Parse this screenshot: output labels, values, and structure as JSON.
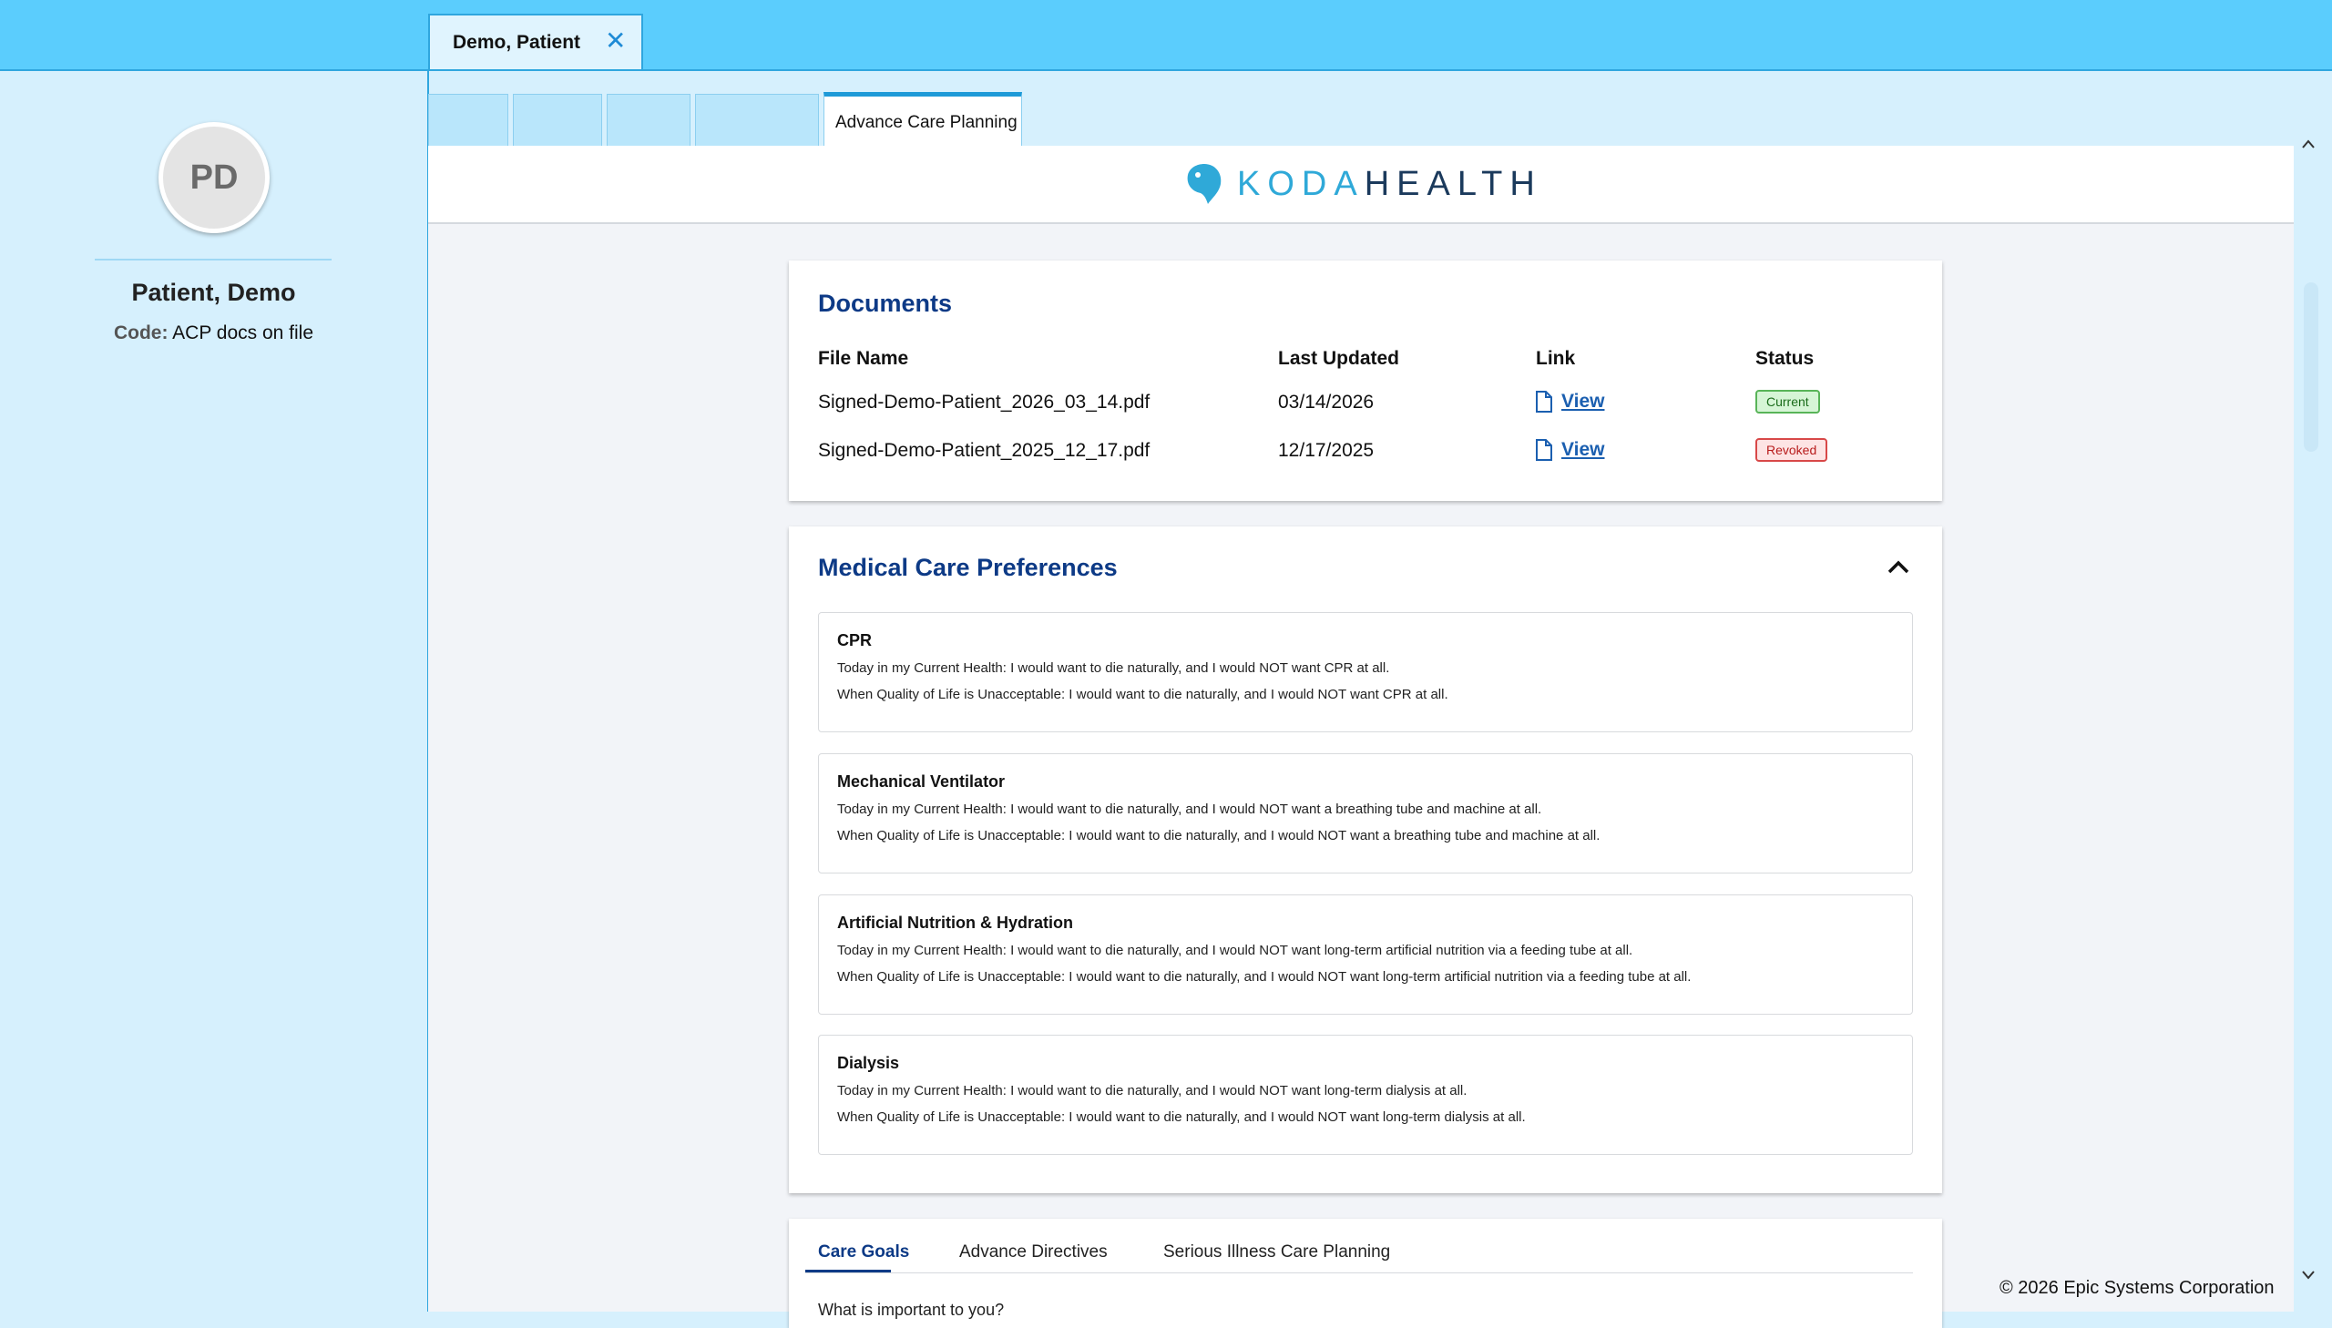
{
  "patient_tab": {
    "name": "Demo, Patient",
    "close": "✕"
  },
  "sidebar": {
    "initials": "PD",
    "name": "Patient, Demo",
    "code_label": "Code:",
    "code_value": "ACP docs on file"
  },
  "subtabs": {
    "active_label": "Advance Care Planning"
  },
  "logo": {
    "part1": "KODA",
    "part2": "HEALTH"
  },
  "documents": {
    "title": "Documents",
    "headers": {
      "file": "File Name",
      "updated": "Last Updated",
      "link": "Link",
      "status": "Status"
    },
    "rows": [
      {
        "file": "Signed-Demo-Patient_2026_03_14.pdf",
        "updated": "03/14/2026",
        "link": "View",
        "status": "Current"
      },
      {
        "file": "Signed-Demo-Patient_2025_12_17.pdf",
        "updated": "12/17/2025",
        "link": "View",
        "status": "Revoked"
      }
    ]
  },
  "preferences": {
    "title": "Medical Care Preferences",
    "items": [
      {
        "title": "CPR",
        "line1": "Today in my Current Health: I would want to die naturally, and I would NOT want CPR at all.",
        "line2": "When Quality of Life is Unacceptable: I would want to die naturally, and I would NOT want CPR at all."
      },
      {
        "title": "Mechanical Ventilator",
        "line1": "Today in my Current Health: I would want to die naturally, and I would NOT want a breathing tube and machine at all.",
        "line2": "When Quality of Life is Unacceptable: I would want to die naturally, and I would NOT want a breathing tube and machine at all."
      },
      {
        "title": "Artificial Nutrition & Hydration",
        "line1": "Today in my Current Health: I would want to die naturally, and I would NOT want long-term artificial nutrition via a feeding tube at all.",
        "line2": "When Quality of Life is Unacceptable: I would want to die naturally, and I would NOT want long-term artificial nutrition via a feeding tube at all."
      },
      {
        "title": "Dialysis",
        "line1": "Today in my Current Health: I would want to die naturally, and I would NOT want long-term dialysis at all.",
        "line2": "When Quality of Life is Unacceptable: I would want to die naturally, and I would NOT want long-term dialysis at all."
      }
    ]
  },
  "bottom_tabs": {
    "tab1": "Care Goals",
    "tab2": "Advance Directives",
    "tab3": "Serious Illness Care Planning"
  },
  "bottom_question": "What is important to you?",
  "footer": "© 2026 Epic Systems Corporation",
  "colors": {
    "accent": "#5bcdfd",
    "heading": "#0d3a86",
    "current": "#58b458",
    "revoked": "#d84848"
  }
}
